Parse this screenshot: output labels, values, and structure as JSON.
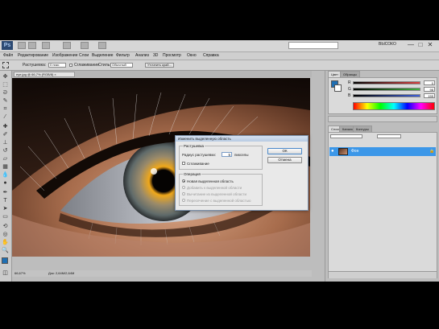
{
  "app": {
    "logo": "Ps",
    "search_placeholder": "",
    "workspace_label": "ВЫСОКО",
    "window_controls": [
      "—",
      "□",
      "✕"
    ]
  },
  "menu": [
    "Файл",
    "Редактирование",
    "Изображение",
    "Слои",
    "Выделение",
    "Фильтр",
    "Анализ",
    "3D",
    "Просмотр",
    "Окно",
    "Справка"
  ],
  "options_bar": {
    "feather_label": "Растушевка:",
    "feather_value": "0 пикс",
    "antialias_label": "Сглаживание",
    "style_label": "Стиль:",
    "style_value": "Обычный",
    "refine_edge": "Уточнить край..."
  },
  "document": {
    "tab_title": "eye.jpg @ 66,7% (RGB/8) ×",
    "zoom": "66,67%",
    "status": "Док: 2,64M/2,64M"
  },
  "panels": {
    "color_tabs": [
      "Цвет",
      "Образцы"
    ],
    "channels": [
      {
        "label": "R",
        "value": "0",
        "color": "#d94040"
      },
      {
        "label": "G",
        "value": "98",
        "color": "#40b040"
      },
      {
        "label": "B",
        "value": "155",
        "color": "#4060d9"
      }
    ],
    "layers_tabs": [
      "Слои",
      "Каналы",
      "Контуры"
    ],
    "layer_name": "Фон"
  },
  "dialog": {
    "title": "Изменить выделенную область",
    "group_radius": "Растушевка",
    "radius_label": "Радиус растушевки:",
    "radius_value": "5",
    "units": "пикселы",
    "smooth_label": "Сглаживание",
    "group_operation": "Операция",
    "op_new": "Новая выделенная область",
    "op_add": "Добавить к выделенной области",
    "op_subtract": "Вычитание из выделенной области",
    "op_intersect": "Пересечение с выделенной областью",
    "ok": "ОК",
    "cancel": "Отмена"
  },
  "colors": {
    "foreground": "#1f6fb3",
    "background": "#ffffff",
    "selected_layer": "#3c97e8"
  }
}
